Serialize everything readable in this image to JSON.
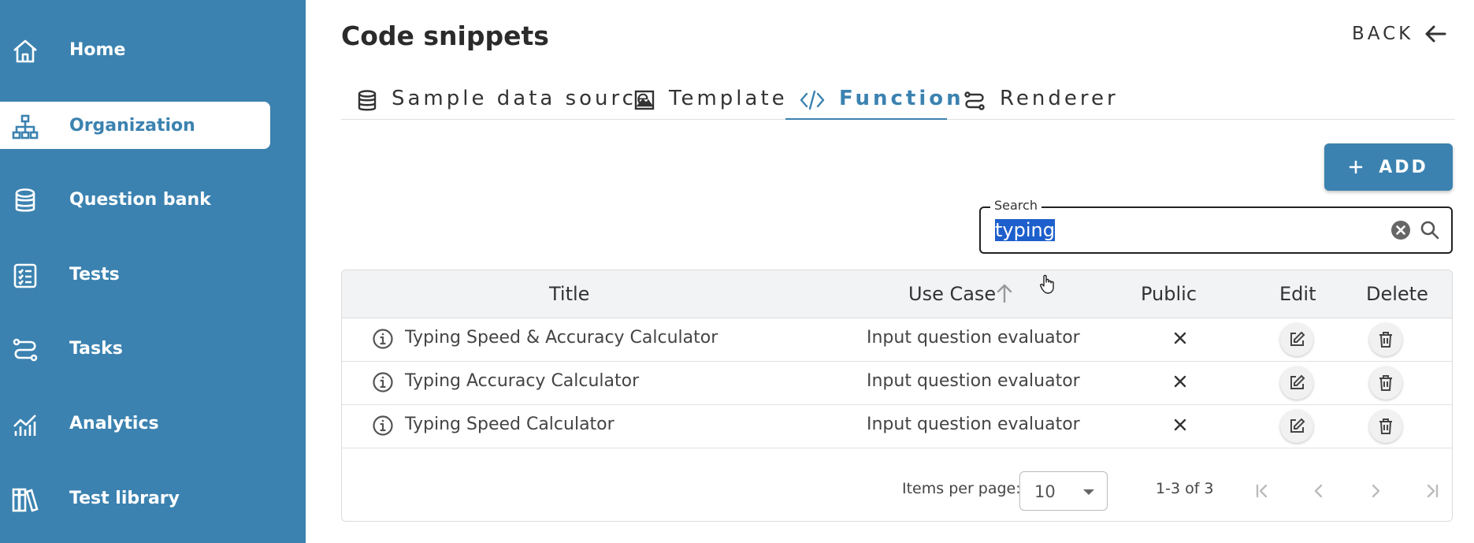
{
  "sidebar": {
    "items": [
      {
        "label": "Home",
        "icon": "home-icon"
      },
      {
        "label": "Organization",
        "icon": "org-tree-icon",
        "active": true
      },
      {
        "label": "Question bank",
        "icon": "database-icon"
      },
      {
        "label": "Tests",
        "icon": "checklist-icon"
      },
      {
        "label": "Tasks",
        "icon": "route-icon"
      },
      {
        "label": "Analytics",
        "icon": "chart-icon"
      },
      {
        "label": "Test library",
        "icon": "books-icon"
      }
    ]
  },
  "header": {
    "title": "Code snippets",
    "back_label": "BACK"
  },
  "tabs": [
    {
      "label": "Sample data source",
      "icon": "database-icon"
    },
    {
      "label": "Template",
      "icon": "image-icon"
    },
    {
      "label": "Function",
      "icon": "code-icon",
      "active": true
    },
    {
      "label": "Renderer",
      "icon": "route-icon"
    }
  ],
  "toolbar": {
    "add_label": "ADD"
  },
  "search": {
    "label": "Search",
    "value": "typing"
  },
  "table": {
    "columns": [
      "Title",
      "Use Case",
      "Public",
      "Edit",
      "Delete"
    ],
    "rows": [
      {
        "title": "Typing Speed & Accuracy Calculator",
        "use_case": "Input question evaluator",
        "public": false
      },
      {
        "title": "Typing Accuracy Calculator",
        "use_case": "Input question evaluator",
        "public": false
      },
      {
        "title": "Typing Speed Calculator",
        "use_case": "Input question evaluator",
        "public": false
      }
    ]
  },
  "pagination": {
    "items_per_page_label": "Items per page:",
    "items_per_page": "10",
    "range": "1-3 of 3"
  },
  "colors": {
    "accent": "#3b82b0",
    "selection": "#1d5fcc"
  }
}
